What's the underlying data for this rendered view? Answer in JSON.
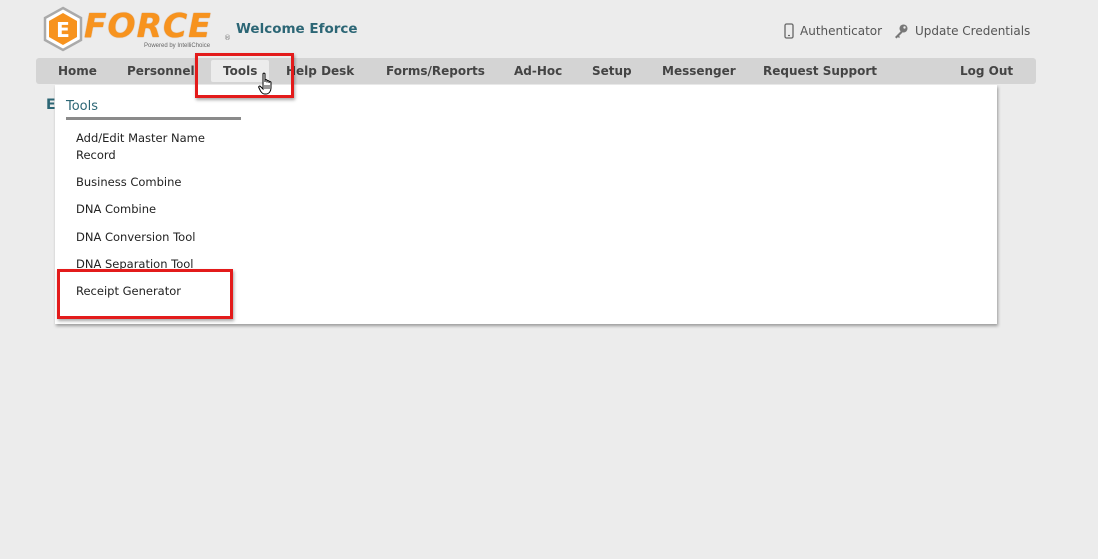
{
  "logo": {
    "wordmark": "FORCE",
    "letter": "E",
    "registered": "®",
    "tagline": "Powered by IntelliChoice"
  },
  "header": {
    "welcome": "Welcome Eforce",
    "authenticator_label": "Authenticator",
    "update_credentials_label": "Update Credentials"
  },
  "nav": {
    "items": [
      {
        "label": "Home"
      },
      {
        "label": "Personnel"
      },
      {
        "label": "Tools"
      },
      {
        "label": "Help Desk"
      },
      {
        "label": "Forms/Reports"
      },
      {
        "label": "Ad-Hoc"
      },
      {
        "label": "Setup"
      },
      {
        "label": "Messenger"
      },
      {
        "label": "Request Support"
      },
      {
        "label": "Log Out"
      }
    ],
    "active": "Tools"
  },
  "page": {
    "title_initial": "E"
  },
  "dropdown": {
    "heading": "Tools",
    "items": [
      {
        "label": "Add/Edit Master Name Record"
      },
      {
        "label": "Business Combine"
      },
      {
        "label": "DNA Combine"
      },
      {
        "label": "DNA Conversion Tool"
      },
      {
        "label": "DNA Separation Tool"
      },
      {
        "label": "Receipt Generator"
      }
    ]
  },
  "colors": {
    "brand_orange": "#f7931e",
    "teal": "#2c6675",
    "highlight_red": "#e31b1b"
  },
  "icons": {
    "authenticator": "phone-icon",
    "update_credentials": "key-icon",
    "cursor": "hand-pointer-icon"
  }
}
